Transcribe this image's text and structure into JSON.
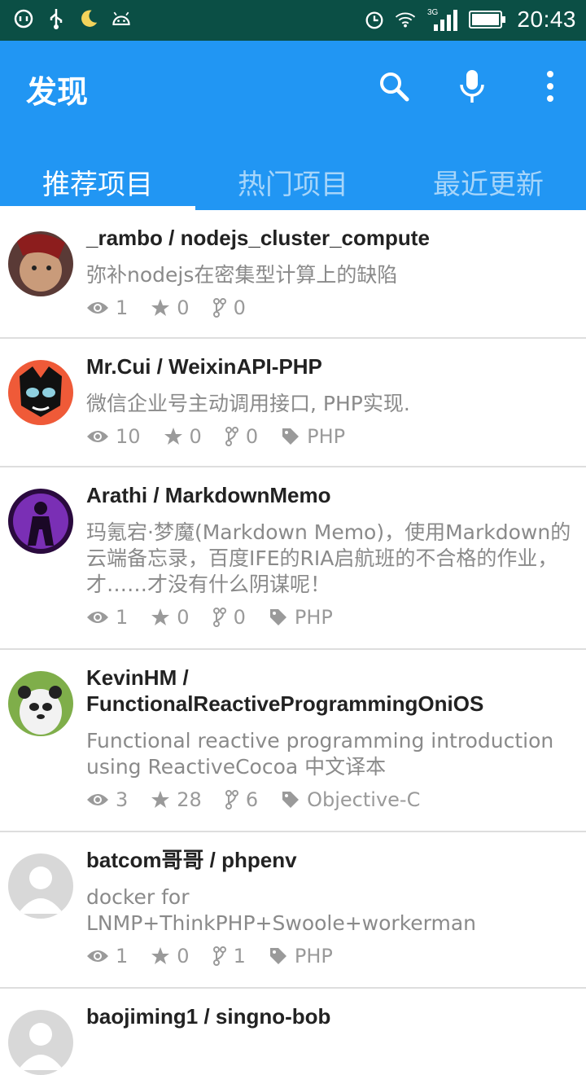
{
  "status_bar": {
    "left_icons": [
      "sync-icon",
      "usb-icon",
      "moon-icon",
      "android-icon"
    ],
    "right_icons": [
      "alarm-icon",
      "wifi-icon",
      "signal-3g-icon",
      "battery-icon"
    ],
    "network": "3G",
    "time": "20:43"
  },
  "app_bar": {
    "title": "发现",
    "actions": [
      "search-icon",
      "mic-icon",
      "more-vert-icon"
    ],
    "accent_color": "#2196f3"
  },
  "tabs": [
    {
      "label": "推荐项目",
      "active": true
    },
    {
      "label": "热门项目",
      "active": false
    },
    {
      "label": "最近更新",
      "active": false
    }
  ],
  "repos": [
    {
      "owner_repo": "_rambo / nodejs_cluster_compute",
      "desc": "弥补nodejs在密集型计算上的缺陷",
      "watch": "1",
      "star": "0",
      "fork": "0",
      "lang": ""
    },
    {
      "owner_repo": "Mr.Cui / WeixinAPI-PHP",
      "desc": "微信企业号主动调用接口, PHP实现.",
      "watch": "10",
      "star": "0",
      "fork": "0",
      "lang": "PHP"
    },
    {
      "owner_repo": "Arathi / MarkdownMemo",
      "desc": "玛氪宕·梦魔(Markdown Memo)，使用Markdown的云端备忘录，百度IFE的RIA启航班的不合格的作业，才……才没有什么阴谋呢！",
      "watch": "1",
      "star": "0",
      "fork": "0",
      "lang": "PHP"
    },
    {
      "owner_repo": "KevinHM / FunctionalReactiveProgrammingOniOS",
      "desc": "Functional reactive programming introduction using ReactiveCocoa 中文译本",
      "watch": "3",
      "star": "28",
      "fork": "6",
      "lang": "Objective-C"
    },
    {
      "owner_repo": "batcom哥哥 / phpenv",
      "desc": "docker for LNMP+ThinkPHP+Swoole+workerman",
      "watch": "1",
      "star": "0",
      "fork": "1",
      "lang": "PHP"
    },
    {
      "owner_repo": "baojiming1 / singno-bob",
      "desc": "",
      "watch": "",
      "star": "",
      "fork": "",
      "lang": ""
    }
  ]
}
